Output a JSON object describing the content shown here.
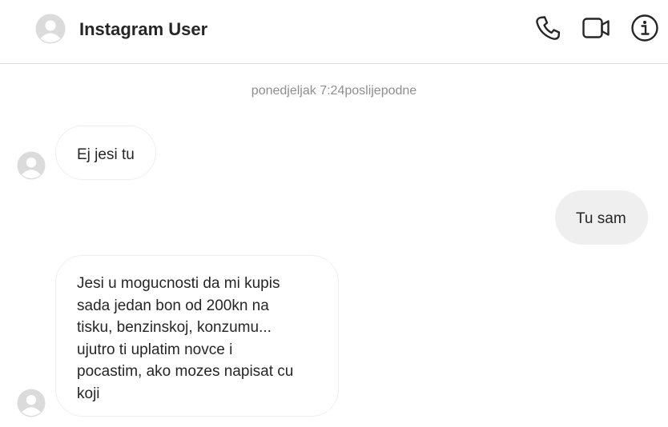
{
  "header": {
    "contact_name": "Instagram User",
    "icons": [
      "avatar-placeholder",
      "phone-icon",
      "video-camera-icon",
      "info-icon"
    ]
  },
  "conversation": {
    "timestamp": "ponedjeljak 7:24poslijepodne",
    "messages": [
      {
        "direction": "incoming",
        "text": "Ej jesi tu"
      },
      {
        "direction": "outgoing",
        "text": "Tu sam"
      },
      {
        "direction": "incoming",
        "lines": [
          "Jesi u mogucnosti da mi kupis",
          "sada jedan bon od 200kn na",
          "tisku, benzinskoj, konzumu...",
          "ujutro ti uplatim novce i",
          "pocastim, ako mozes napisat cu",
          "koji"
        ]
      }
    ]
  },
  "colors": {
    "incoming_border": "#efefef",
    "outgoing_bg": "#efefef",
    "timestamp": "#8e8e8e",
    "divider": "#dbdbdb"
  }
}
